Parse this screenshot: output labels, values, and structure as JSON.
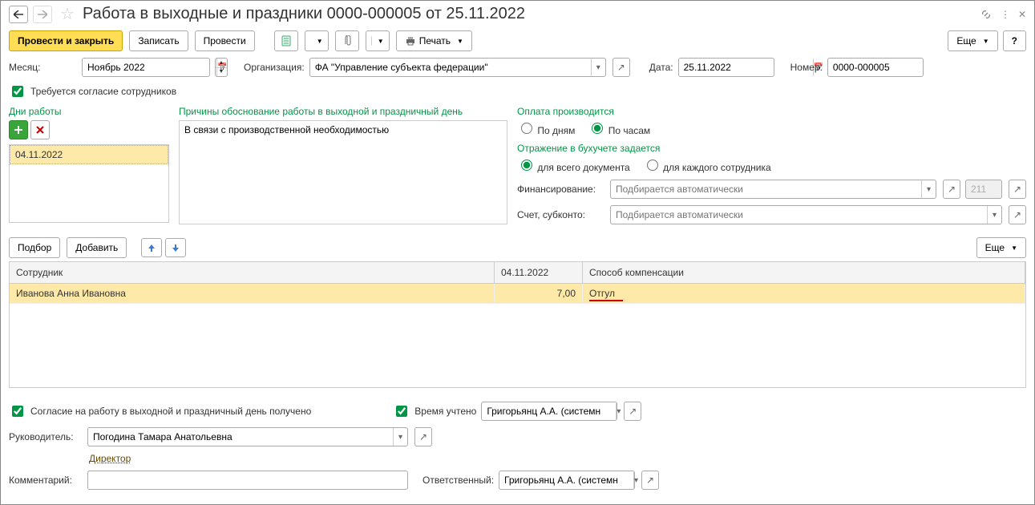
{
  "title": "Работа в выходные и праздники 0000-000005 от 25.11.2022",
  "toolbar": {
    "post_close": "Провести и закрыть",
    "save": "Записать",
    "post": "Провести",
    "print": "Печать",
    "more": "Еще",
    "help": "?"
  },
  "fields": {
    "month_label": "Месяц:",
    "month_value": "Ноябрь 2022",
    "org_label": "Организация:",
    "org_value": "ФА \"Управление субъекта федерации\"",
    "date_label": "Дата:",
    "date_value": "25.11.2022",
    "number_label": "Номер:",
    "number_value": "0000-000005"
  },
  "consent_required": "Требуется согласие сотрудников",
  "days": {
    "label": "Дни работы",
    "items": [
      "04.11.2022"
    ]
  },
  "reason": {
    "label": "Причины обоснование работы в выходной и праздничный день",
    "value": "В связи с производственной необходимостью"
  },
  "payment": {
    "label": "Оплата производится",
    "by_days": "По дням",
    "by_hours": "По часам"
  },
  "accounting": {
    "label": "Отражение в бухучете задается",
    "whole_doc": "для всего документа",
    "per_emp": "для каждого сотрудника"
  },
  "financing": {
    "label": "Финансирование:",
    "placeholder": "Подбирается автоматически"
  },
  "account": {
    "label": "Счет, субконто:",
    "placeholder": "Подбирается автоматически"
  },
  "stat_code": "211",
  "table_toolbar": {
    "pick": "Подбор",
    "add": "Добавить",
    "more": "Еще"
  },
  "table": {
    "head": {
      "employee": "Сотрудник",
      "date": "04.11.2022",
      "compensation": "Способ компенсации"
    },
    "rows": [
      {
        "employee": "Иванова Анна Ивановна",
        "value": "7,00",
        "compensation": "Отгул"
      }
    ]
  },
  "footer": {
    "consent_received": "Согласие на работу в выходной и праздничный день получено",
    "time_counted": "Время учтено",
    "time_user": "Григорьянц А.А. (системн",
    "manager_label": "Руководитель:",
    "manager_value": "Погодина Тамара Анатольевна",
    "director": "Директор",
    "comment_label": "Комментарий:",
    "responsible_label": "Ответственный:",
    "responsible_value": "Григорьянц А.А. (системн"
  }
}
